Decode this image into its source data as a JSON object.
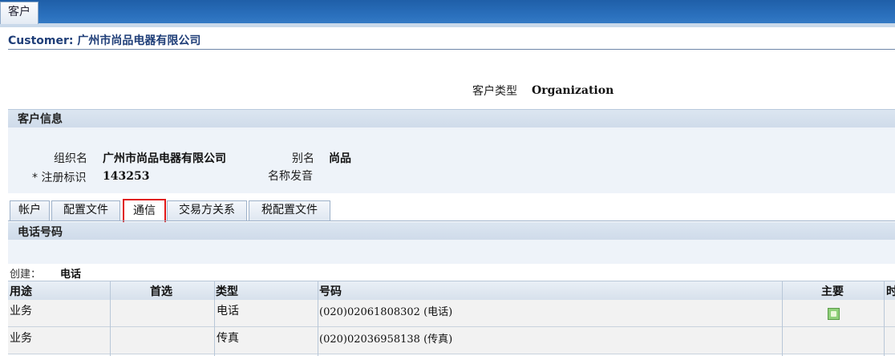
{
  "window": {
    "tab": "客户"
  },
  "page": {
    "title": "Customer: 广州市尚品电器有限公司"
  },
  "customer_type": {
    "label": "客户类型",
    "value": "Organization"
  },
  "customer_info": {
    "header": "客户信息",
    "org_name_label": "组织名",
    "org_name_value": "广州市尚品电器有限公司",
    "alias_label": "别名",
    "alias_value": "尚品",
    "reg_id_label": "* 注册标识",
    "reg_id_value": "143253",
    "pronunciation_label": "名称发音"
  },
  "tabs": [
    {
      "label": "帐户"
    },
    {
      "label": "配置文件"
    },
    {
      "label": "通信"
    },
    {
      "label": "交易方关系"
    },
    {
      "label": "税配置文件"
    }
  ],
  "phone": {
    "header": "电话号码",
    "create_label": "创建：",
    "create_value": "电话",
    "columns": [
      "用途",
      "首选",
      "类型",
      "号码",
      "主要",
      "时"
    ],
    "rows": [
      {
        "purpose": "业务",
        "preferred": "",
        "type": "电话",
        "number": "(020)02061808302 (电话)",
        "primary_icon": "check-icon"
      },
      {
        "purpose": "业务",
        "preferred": "",
        "type": "传真",
        "number": "(020)02036958138 (传真)"
      }
    ]
  }
}
